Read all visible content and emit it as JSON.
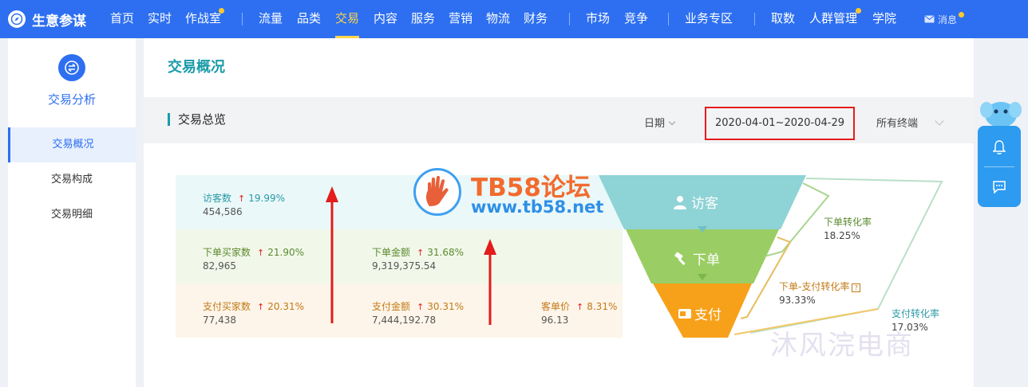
{
  "brand": {
    "name": "生意参谋"
  },
  "nav": {
    "items": [
      "首页",
      "实时",
      "作战室",
      "流量",
      "品类",
      "交易",
      "内容",
      "服务",
      "营销",
      "物流",
      "财务",
      "市场",
      "竞争",
      "业务专区",
      "取数",
      "人群管理",
      "学院"
    ],
    "active": "交易",
    "message_label": "消息"
  },
  "sidebar": {
    "title": "交易分析",
    "items": [
      "交易概况",
      "交易构成",
      "交易明细"
    ],
    "active": "交易概况"
  },
  "main": {
    "page_title": "交易概况",
    "section_title": "交易总览",
    "date_label": "日期",
    "date_range": "2020-04-01~2020-04-29",
    "terminal": "所有终端"
  },
  "metrics": {
    "visitors": {
      "label": "访客数",
      "change": "19.99%",
      "value": "454,586"
    },
    "order_buyers": {
      "label": "下单买家数",
      "change": "21.90%",
      "value": "82,965"
    },
    "order_amount": {
      "label": "下单金额",
      "change": "31.68%",
      "value": "9,319,375.54"
    },
    "pay_buyers": {
      "label": "支付买家数",
      "change": "20.31%",
      "value": "77,438"
    },
    "pay_amount": {
      "label": "支付金额",
      "change": "30.31%",
      "value": "7,444,192.78"
    },
    "unit_price": {
      "label": "客单价",
      "change": "8.31%",
      "value": "96.13"
    }
  },
  "funnel": {
    "stages": [
      "访客",
      "下单",
      "支付"
    ],
    "colors": {
      "visit": "#8ed3d6",
      "order": "#9acd63",
      "pay": "#f7a11a"
    },
    "rates": {
      "order_rate": {
        "label": "下单转化率",
        "value": "18.25%"
      },
      "order_pay_rate": {
        "label": "下单-支付转化率",
        "value": "93.33%"
      },
      "pay_rate": {
        "label": "支付转化率",
        "value": "17.03%"
      }
    }
  },
  "watermark": {
    "title": "TB58论坛",
    "url": "www.tb58.net",
    "cn": "沐风浣电商"
  }
}
